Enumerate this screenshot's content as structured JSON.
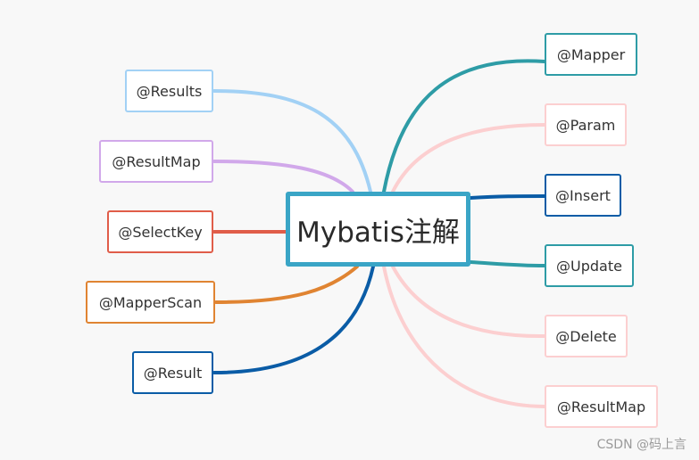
{
  "center": {
    "label": "Mybatis注解",
    "color": "#3aa5c6"
  },
  "left_nodes": [
    {
      "label": "@Results",
      "color": "#a2d1f5"
    },
    {
      "label": "@ResultMap",
      "color": "#d1a8ea"
    },
    {
      "label": "@SelectKey",
      "color": "#e05d49"
    },
    {
      "label": "@MapperScan",
      "color": "#e08432"
    },
    {
      "label": "@Result",
      "color": "#0a5ca6"
    }
  ],
  "right_nodes": [
    {
      "label": "@Mapper",
      "color": "#2e9ca6"
    },
    {
      "label": "@Param",
      "color": "#fccfd0"
    },
    {
      "label": "@Insert",
      "color": "#0a5ca6"
    },
    {
      "label": "@Update",
      "color": "#2e9ca6"
    },
    {
      "label": "@Delete",
      "color": "#fccfd0"
    },
    {
      "label": "@ResultMap",
      "color": "#fccfd0"
    }
  ],
  "watermark": "CSDN @码上言"
}
